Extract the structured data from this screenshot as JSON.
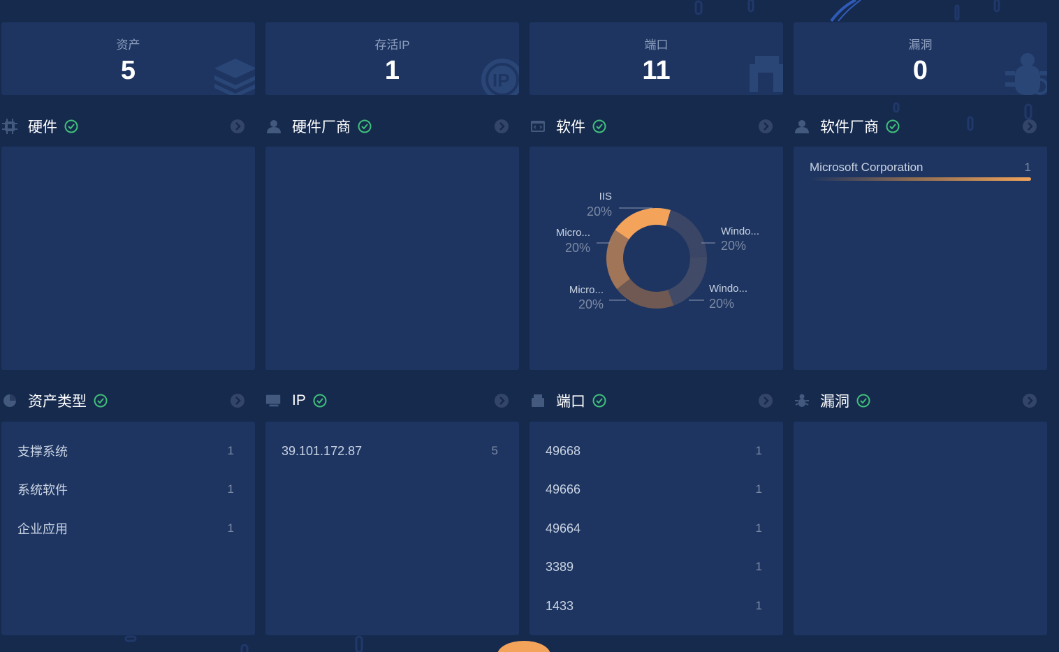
{
  "stats": [
    {
      "label": "资产",
      "value": "5",
      "icon": "layers-icon"
    },
    {
      "label": "存活IP",
      "value": "1",
      "icon": "ip-icon"
    },
    {
      "label": "端口",
      "value": "11",
      "icon": "port-icon"
    },
    {
      "label": "漏洞",
      "value": "0",
      "icon": "bug-icon"
    }
  ],
  "sections": {
    "hardware": {
      "title": "硬件"
    },
    "hardware_vendor": {
      "title": "硬件厂商"
    },
    "software": {
      "title": "软件"
    },
    "software_vendor": {
      "title": "软件厂商"
    },
    "asset_type": {
      "title": "资产类型"
    },
    "ip": {
      "title": "IP"
    },
    "port": {
      "title": "端口"
    },
    "vuln": {
      "title": "漏洞"
    }
  },
  "software_chart": {
    "type": "pie",
    "slices": [
      {
        "name": "IIS",
        "percent": "20%",
        "value": 20,
        "color": "#f3a35a"
      },
      {
        "name": "Windo...",
        "percent": "20%",
        "value": 20,
        "color": "#3b4565"
      },
      {
        "name": "Windo...",
        "percent": "20%",
        "value": 20,
        "color": "#414a66"
      },
      {
        "name": "Micro...",
        "percent": "20%",
        "value": 20,
        "color": "#6f5952"
      },
      {
        "name": "Micro...",
        "percent": "20%",
        "value": 20,
        "color": "#a07558"
      }
    ]
  },
  "chart_data": {
    "type": "pie",
    "categories": [
      "IIS",
      "Windo...",
      "Windo...",
      "Micro...",
      "Micro..."
    ],
    "values": [
      20,
      20,
      20,
      20,
      20
    ]
  },
  "software_vendor": {
    "items": [
      {
        "name": "Microsoft Corporation",
        "count": "1",
        "fraction": 1.0
      }
    ]
  },
  "asset_types": [
    {
      "name": "支撑系统",
      "count": "1"
    },
    {
      "name": "系统软件",
      "count": "1"
    },
    {
      "name": "企业应用",
      "count": "1"
    }
  ],
  "ips": [
    {
      "name": "39.101.172.87",
      "count": "5"
    }
  ],
  "ports": [
    {
      "name": "49668",
      "count": "1"
    },
    {
      "name": "49666",
      "count": "1"
    },
    {
      "name": "49664",
      "count": "1"
    },
    {
      "name": "3389",
      "count": "1"
    },
    {
      "name": "1433",
      "count": "1"
    }
  ],
  "colors": {
    "background": "#162a4e",
    "panel": "#1e3561",
    "accent": "#f3a35a",
    "check": "#3fc07a"
  }
}
